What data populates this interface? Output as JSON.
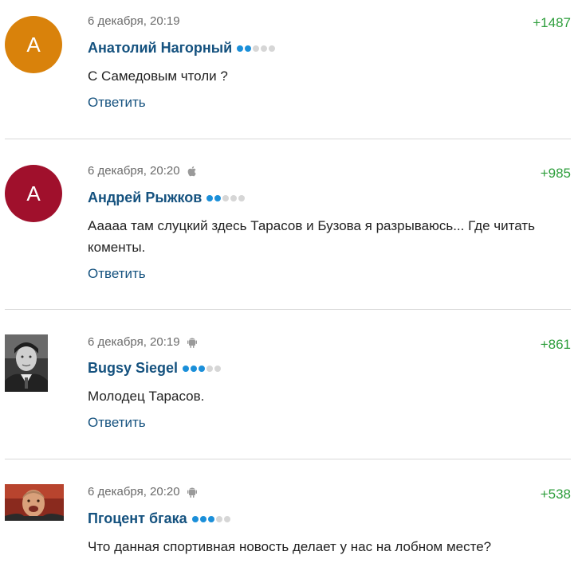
{
  "comments": [
    {
      "avatar_letter": "A",
      "avatar_color": "#d9820b",
      "date": "6 декабря, 20:19",
      "device": "",
      "score": "+1487",
      "author": "Анатолий Нагорный",
      "rating_level": 2,
      "text": "С Самедовым чтоли ?",
      "reply_label": "Ответить"
    },
    {
      "avatar_letter": "A",
      "avatar_color": "#a0102c",
      "date": "6 декабря, 20:20",
      "device": "apple-icon",
      "score": "+985",
      "author": "Андрей Рыжков",
      "rating_level": 2,
      "text": "Ааааа там слуцкий здесь Тарасов и Бузова я разрываюсь... Где читать коменты.",
      "reply_label": "Ответить"
    },
    {
      "avatar_letter": "",
      "avatar_color": "",
      "date": "6 декабря, 20:19",
      "device": "android-icon",
      "score": "+861",
      "author": "Bugsy Siegel",
      "rating_level": 3,
      "text": "Молодец Тарасов.",
      "reply_label": "Ответить"
    },
    {
      "avatar_letter": "",
      "avatar_color": "",
      "date": "6 декабря, 20:20",
      "device": "android-icon",
      "score": "+538",
      "author": "Пгоцент бгака",
      "rating_level": 3,
      "text": "Что данная спортивная новость делает у нас на лобном месте?",
      "reply_label": ""
    }
  ],
  "colors": {
    "author": "#15527f",
    "score": "#2e9e3c",
    "rating_on": "#1b8fd9",
    "rating_off": "#d6d6d6"
  }
}
